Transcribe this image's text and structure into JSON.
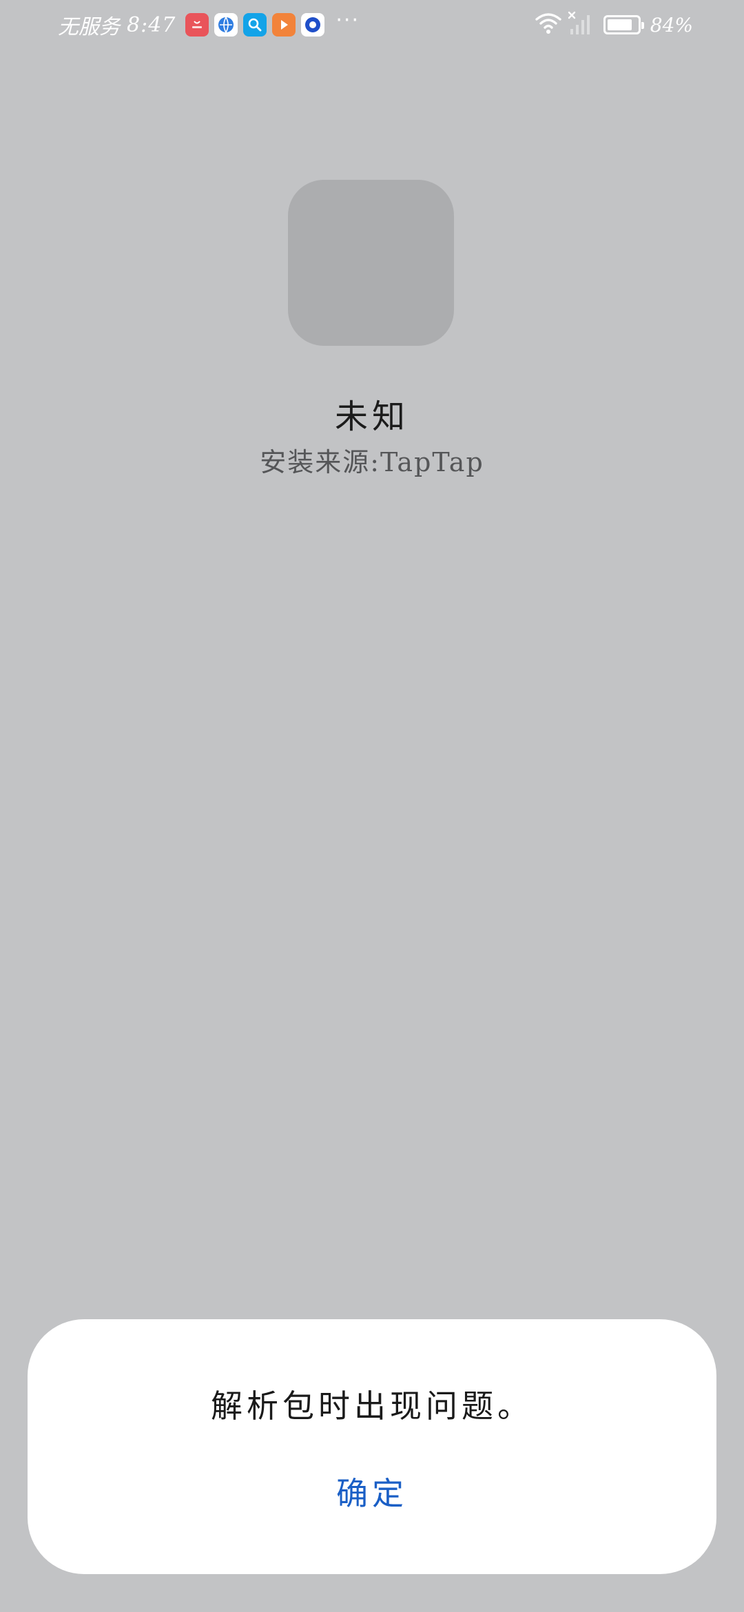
{
  "status_bar": {
    "carrier": "无服务",
    "time": "8:47",
    "notification_icons": [
      "huawei-store-icon",
      "browser-icon",
      "search-icon",
      "video-icon",
      "app-icon"
    ],
    "more": "···",
    "battery_level": 0.84,
    "battery_text": "84%"
  },
  "app": {
    "name": "未知",
    "install_source": "安装来源:TapTap"
  },
  "dialog": {
    "message": "解析包时出现问题。",
    "confirm_label": "确定"
  },
  "colors": {
    "background": "#c2c3c5",
    "icon_placeholder": "#acadaf",
    "dialog_bg": "#ffffff",
    "accent": "#1a5fc6"
  }
}
